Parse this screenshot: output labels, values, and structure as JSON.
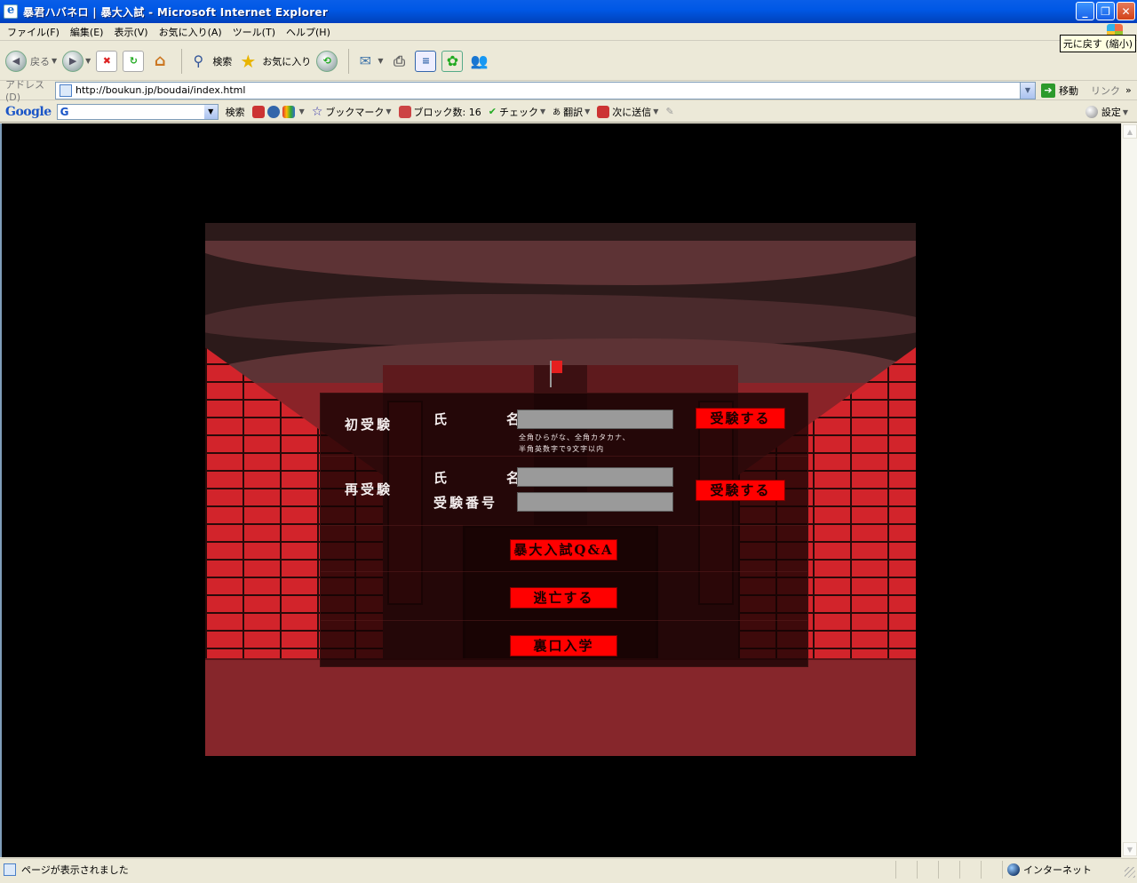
{
  "window": {
    "title": "暴君ハバネロ | 暴大入試 - Microsoft Internet Explorer",
    "tooltip": "元に戻す (縮小)"
  },
  "menu": [
    "ファイル(F)",
    "編集(E)",
    "表示(V)",
    "お気に入り(A)",
    "ツール(T)",
    "ヘルプ(H)"
  ],
  "toolbar": {
    "back": "戻る",
    "search": "検索",
    "favorites": "お気に入り"
  },
  "address": {
    "label": "アドレス(D)",
    "url": "http://boukun.jp/boudai/index.html",
    "go": "移動",
    "links": "リンク"
  },
  "google": {
    "logo": "Google",
    "search": "検索",
    "bookmarks": "ブックマーク",
    "blocked": "ブロック数: 16",
    "check": "チェック",
    "translate": "翻訳",
    "send": "次に送信",
    "settings": "設定"
  },
  "form": {
    "first_exam": {
      "label": "初受験",
      "name_label": "氏　名",
      "name_value": "",
      "note_line1": "全角ひらがな、全角カタカナ、",
      "note_line2": "半角英数字で9文字以内",
      "submit": "受験する"
    },
    "re_exam": {
      "label": "再受験",
      "name_label": "氏　名",
      "name_value": "",
      "number_label": "受験番号",
      "number_value": "",
      "submit": "受験する"
    },
    "qa_button": "暴大入試Q&A",
    "escape_button": "逃亡する",
    "backdoor_button": "裏口入学"
  },
  "status": {
    "message": "ページが表示されました",
    "zone": "インターネット"
  },
  "colors": {
    "button_red": "#ff0000",
    "brick_red": "#d2242b",
    "title_blue": "#0058e6"
  }
}
